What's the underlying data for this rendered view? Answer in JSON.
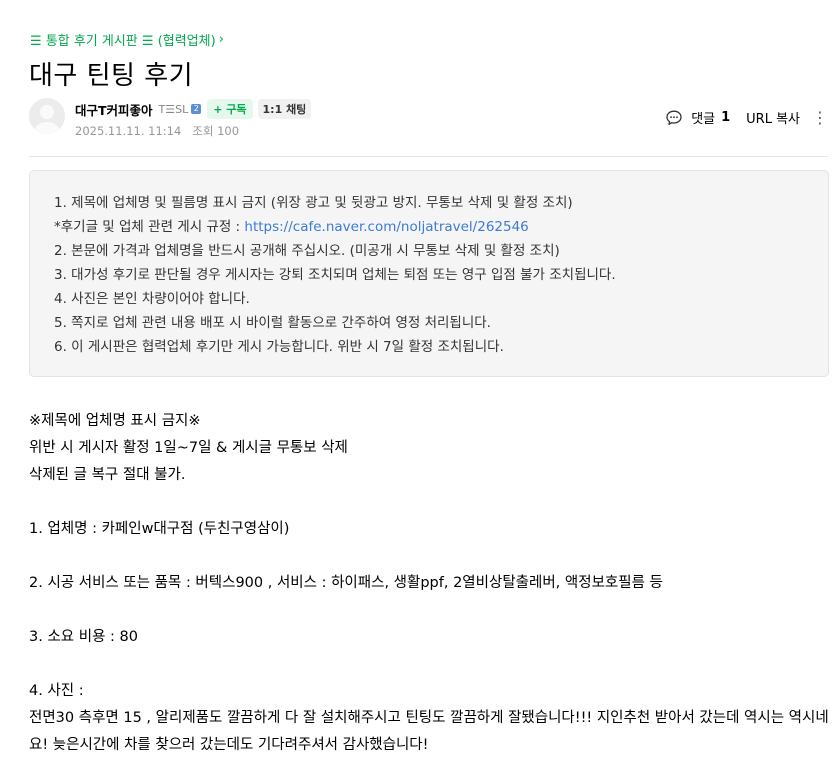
{
  "board": {
    "link_label": "☰ 통합 후기 게시판 ☰ (협력업체)",
    "chevron": "›"
  },
  "post": {
    "title": "대구 틴팅 후기"
  },
  "author": {
    "name": "대구T커피좋아",
    "level": "T☰SL",
    "level_badge": "2",
    "subscribe_label": "+ 구독",
    "chat_label": "1:1 채팅"
  },
  "meta": {
    "datetime": "2025.11.11. 11:14",
    "views": "조회 100"
  },
  "actions": {
    "comment_label": "댓글",
    "comment_count": "1",
    "url_copy_label": "URL 복사",
    "more_icon": "⋮"
  },
  "notice": {
    "line1": "1. 제목에 업체명 및 필름명 표시 금지 (위장 광고 및 뒷광고 방지. 무통보 삭제 및 활정 조치)",
    "line2_prefix": "*후기글 및 업체 관련 게시 규정 : ",
    "line2_link": "https://cafe.naver.com/noljatravel/262546",
    "line3": "2. 본문에 가격과 업체명을 반드시 공개해 주십시오. (미공개 시 무통보 삭제 및 활정 조치)",
    "line4": "3. 대가성 후기로 판단될 경우 게시자는 강퇴 조치되며 업체는 퇴점 또는 영구 입점 불가 조치됩니다.",
    "line5": "4. 사진은 본인 차량이어야 합니다.",
    "line6": "5. 쪽지로 업체 관련 내용 배포 시 바이럴 활동으로 간주하여 영정 처리됩니다.",
    "line7": "6. 이 게시판은 협력업체 후기만 게시 가능합니다. 위반 시 7일 활정 조치됩니다."
  },
  "content": {
    "warn1": "※제목에 업체명 표시 금지※",
    "warn2": "위반 시 게시자 활정 1일~7일 & 게시글 무통보 삭제",
    "warn3": "삭제된 글 복구 절대 불가.",
    "q1": "1. 업체명 :  카페인w대구점 (두친구영삼이)",
    "q2": "2. 시공 서비스 또는 품목 :  버텍스900 , 서비스 : 하이패스, 생활ppf, 2열비상탈출레버, 액정보호필름 등",
    "q3": "3. 소요 비용 :  80",
    "q4": "4. 사진 :",
    "review": "전면30 측후면 15 , 알리제품도 깔끔하게 다 잘 설치해주시고 틴팅도 깔끔하게 잘됐습니다!!! 지인추천 받아서 갔는데 역시는 역시네요! 늦은시간에 차를 찾으러 갔는데도 기다려주셔서 감사했습니다!"
  },
  "colors": {
    "accent_green": "#03a94d",
    "link_blue": "#3d7bd6",
    "notice_bg": "#f5f5f5"
  }
}
